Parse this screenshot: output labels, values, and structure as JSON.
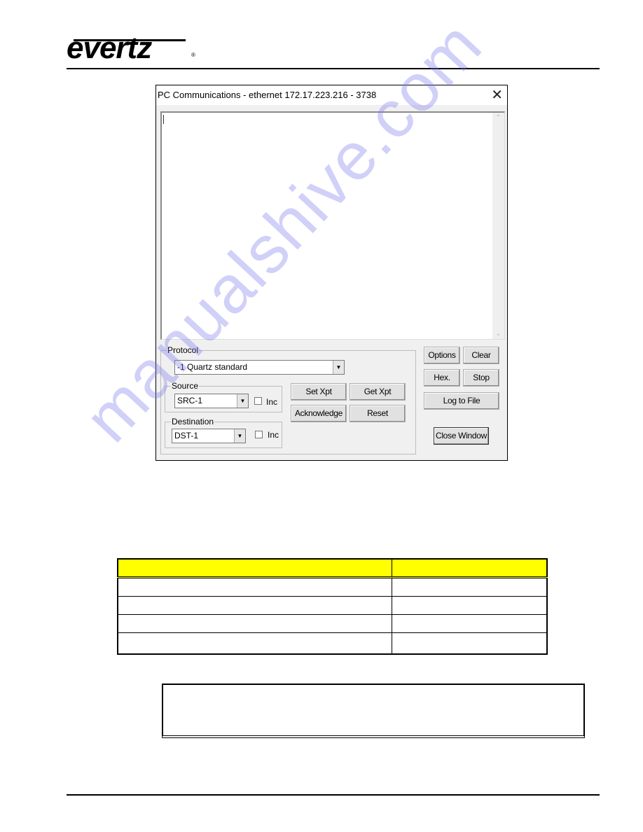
{
  "header": {
    "logo_text": "evertz",
    "logo_reg": "®"
  },
  "dialog": {
    "title": "PC Communications - ethernet 172.17.223.216 - 3738",
    "close_glyph": "✕",
    "log_text": "",
    "scroll_up_glyph": "⌃",
    "scroll_down_glyph": "⌄",
    "protocol": {
      "legend": "Protocol",
      "selected": "-1  Quartz standard"
    },
    "source": {
      "legend": "Source",
      "selected": "SRC-1",
      "inc_label": "Inc",
      "inc_checked": false
    },
    "destination": {
      "legend": "Destination",
      "selected": "DST-1",
      "inc_label": "Inc",
      "inc_checked": false
    },
    "combo_arrow_glyph": "▼",
    "buttons": {
      "set_xpt": "Set Xpt",
      "get_xpt": "Get Xpt",
      "acknowledge": "Acknowledge",
      "reset": "Reset",
      "options": "Options",
      "clear": "Clear",
      "hex": "Hex.",
      "stop": "Stop",
      "log_to_file": "Log to File",
      "close_window": "Close Window"
    }
  },
  "table": {
    "header": [
      "",
      ""
    ],
    "rows": [
      [
        "",
        ""
      ],
      [
        "",
        ""
      ],
      [
        "",
        ""
      ],
      [
        "",
        ""
      ]
    ]
  },
  "note": {
    "text": ""
  },
  "watermark": {
    "text": "manualshive.com",
    "color": "#7878eb"
  }
}
